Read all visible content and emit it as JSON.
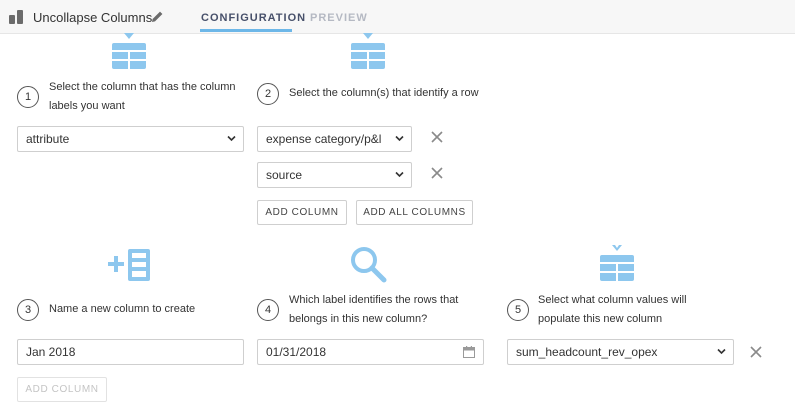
{
  "header": {
    "title": "Uncollapse Columns",
    "tabs": [
      {
        "label": "CONFIGURATION",
        "active": true
      },
      {
        "label": "PREVIEW",
        "active": false
      }
    ]
  },
  "colors": {
    "accent": "#6db7e8",
    "icon": "#8dc7ee"
  },
  "steps": [
    {
      "number": "1",
      "label_line1": "Select the column that has the column",
      "label_line2": "labels you want",
      "icon": "table-arrow-down-icon"
    },
    {
      "number": "2",
      "label_line1": "Select the column(s) that identify a row",
      "icon": "table-arrow-down-icon"
    },
    {
      "number": "3",
      "label_line1": "Name a new column to create",
      "icon": "add-column-icon"
    },
    {
      "number": "4",
      "label_line1": "Which label identifies the rows that",
      "label_line2": "belongs in this new column?",
      "icon": "search-icon"
    },
    {
      "number": "5",
      "label_line1": "Select what column values will",
      "label_line2": "populate this new column",
      "icon": "table-arrow-down-icon"
    }
  ],
  "step1": {
    "selected": "attribute"
  },
  "step2": {
    "rows": [
      {
        "selected": "expense category/p&l"
      },
      {
        "selected": "source"
      }
    ],
    "add_column_label": "ADD COLUMN",
    "add_all_columns_label": "ADD ALL COLUMNS"
  },
  "step3": {
    "value": "Jan 2018"
  },
  "step4": {
    "value": "01/31/2018"
  },
  "step5": {
    "selected": "sum_headcount_rev_opex"
  },
  "footer": {
    "add_column_label": "ADD COLUMN"
  }
}
